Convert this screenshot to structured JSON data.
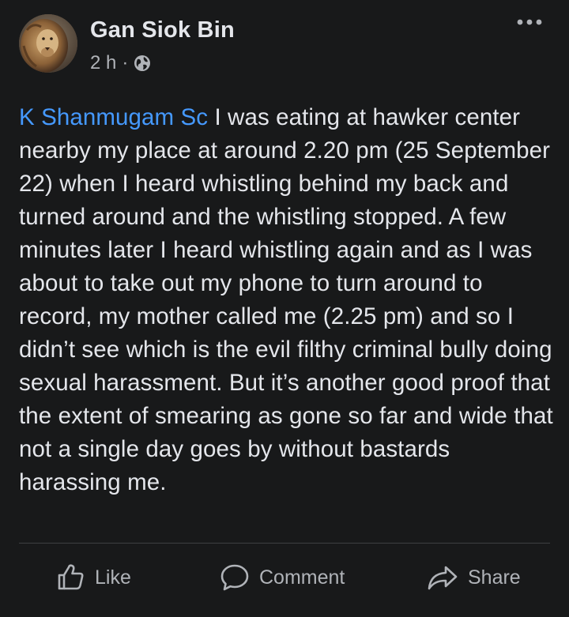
{
  "post": {
    "author": "Gan Siok Bin",
    "time": "2 h",
    "separator": "·",
    "mention": "K Shanmugam Sc",
    "body": " I was eating at hawker center nearby my place at around 2.20 pm (25 September 22) when I heard whistling behind my back and turned around and the whistling stopped. A few minutes later I heard whistling again and as I was about to take out my phone to turn around to record, my mother called me (2.25 pm) and so I didn’t see which is the evil filthy criminal bully doing sexual harassment. But it’s another good proof that the extent of smearing as gone so far and wide that not a single day goes by without bastards harassing me."
  },
  "actions": {
    "like_label": "Like",
    "comment_label": "Comment",
    "share_label": "Share"
  },
  "icons": {
    "privacy": "globe-icon",
    "more": "more-horizontal-icon",
    "like": "thumbs-up-icon",
    "comment": "speech-bubble-icon",
    "share": "share-arrow-icon"
  },
  "colors": {
    "background": "#18191a",
    "text": "#e4e6eb",
    "secondary_text": "#b0b3b8",
    "link": "#4599ff",
    "divider": "#3e4042"
  }
}
